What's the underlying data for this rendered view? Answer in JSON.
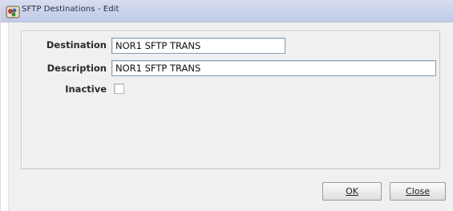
{
  "window": {
    "title": "SFTP Destinations - Edit",
    "icon": "app-icon"
  },
  "form": {
    "destination_label": "Destination",
    "destination_value": "NOR1 SFTP TRANS",
    "description_label": "Description",
    "description_value": "NOR1 SFTP TRANS",
    "inactive_label": "Inactive",
    "inactive_checked": false
  },
  "buttons": {
    "ok_label": "OK",
    "close_label": "Close"
  }
}
